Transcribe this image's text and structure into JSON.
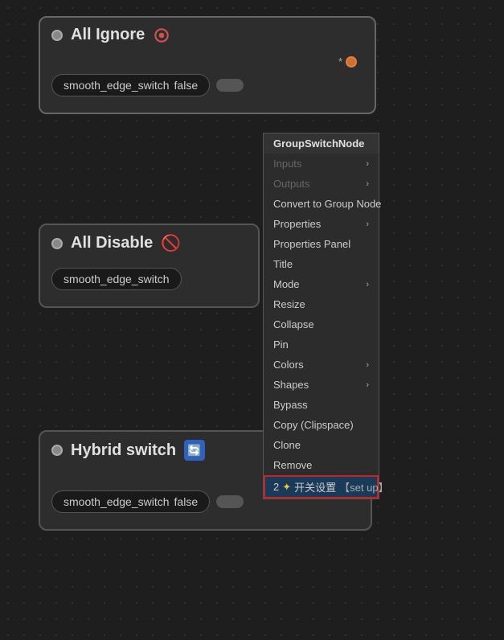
{
  "canvas": {
    "bg_color": "#1e1e1e"
  },
  "nodes": [
    {
      "id": "node-1",
      "title": "All Ignore",
      "icon_type": "circle-o",
      "input_label": "smooth_edge_switch",
      "input_value": "false",
      "has_star": true,
      "has_orange_dot": true
    },
    {
      "id": "node-2",
      "title": "All Disable",
      "icon_type": "no-entry",
      "input_label": "smooth_edge_switch",
      "input_value": "",
      "has_star": false,
      "has_orange_dot": false
    },
    {
      "id": "node-3",
      "title": "Hybrid switch",
      "icon_type": "recycle",
      "input_label": "smooth_edge_switch",
      "input_value": "false",
      "has_star": true,
      "has_orange_dot": true
    }
  ],
  "context_menu": {
    "items": [
      {
        "label": "GroupSwitchNode",
        "type": "header",
        "has_arrow": false
      },
      {
        "label": "Inputs",
        "type": "disabled",
        "has_arrow": true
      },
      {
        "label": "Outputs",
        "type": "disabled",
        "has_arrow": true
      },
      {
        "label": "Convert to Group Node",
        "type": "normal",
        "has_arrow": false
      },
      {
        "label": "Properties",
        "type": "normal",
        "has_arrow": true
      },
      {
        "label": "Properties Panel",
        "type": "normal",
        "has_arrow": false
      },
      {
        "label": "Title",
        "type": "normal",
        "has_arrow": false
      },
      {
        "label": "Mode",
        "type": "normal",
        "has_arrow": true
      },
      {
        "label": "Resize",
        "type": "normal",
        "has_arrow": false
      },
      {
        "label": "Collapse",
        "type": "normal",
        "has_arrow": false
      },
      {
        "label": "Pin",
        "type": "normal",
        "has_arrow": false
      },
      {
        "label": "Colors",
        "type": "normal",
        "has_arrow": true
      },
      {
        "label": "Shapes",
        "type": "normal",
        "has_arrow": true
      },
      {
        "label": "Bypass",
        "type": "normal",
        "has_arrow": false
      },
      {
        "label": "Copy (Clipspace)",
        "type": "normal",
        "has_arrow": false
      },
      {
        "label": "Clone",
        "type": "normal",
        "has_arrow": false
      },
      {
        "label": "Remove",
        "type": "normal",
        "has_arrow": false
      },
      {
        "label": "2",
        "star": "✦",
        "chinese": "开关设置",
        "bracket": "【set up】",
        "type": "highlighted",
        "has_arrow": false
      }
    ]
  }
}
